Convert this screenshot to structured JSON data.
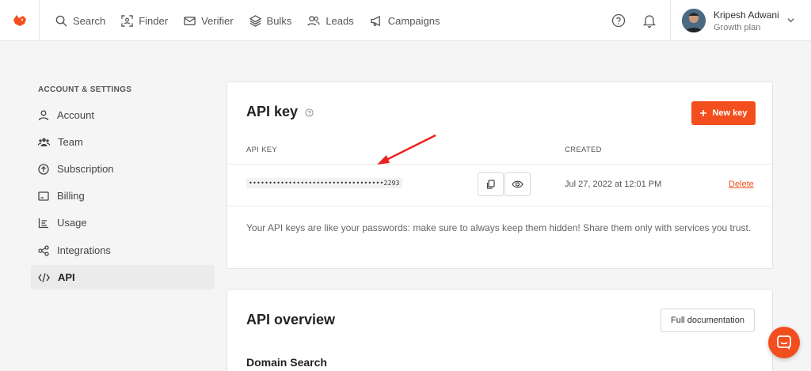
{
  "nav": {
    "items": [
      {
        "label": "Search",
        "icon": "search-icon"
      },
      {
        "label": "Finder",
        "icon": "finder-icon"
      },
      {
        "label": "Verifier",
        "icon": "verifier-icon"
      },
      {
        "label": "Bulks",
        "icon": "layers-icon"
      },
      {
        "label": "Leads",
        "icon": "users-icon"
      },
      {
        "label": "Campaigns",
        "icon": "megaphone-icon"
      }
    ]
  },
  "user": {
    "name": "Kripesh Adwani",
    "plan": "Growth plan"
  },
  "sidebar": {
    "title": "ACCOUNT & SETTINGS",
    "items": [
      {
        "label": "Account",
        "icon": "user-icon"
      },
      {
        "label": "Team",
        "icon": "team-icon"
      },
      {
        "label": "Subscription",
        "icon": "arrow-up-circle-icon"
      },
      {
        "label": "Billing",
        "icon": "billing-icon"
      },
      {
        "label": "Usage",
        "icon": "usage-chart-icon"
      },
      {
        "label": "Integrations",
        "icon": "share-nodes-icon"
      },
      {
        "label": "API",
        "icon": "code-icon"
      }
    ],
    "active": "API"
  },
  "api_key_card": {
    "title": "API key",
    "new_key_label": "New key",
    "col_key": "API KEY",
    "col_created": "CREATED",
    "key_masked": "••••••••••••••••••••••••••••••••••2293",
    "created": "Jul 27, 2022 at 12:01 PM",
    "delete_label": "Delete",
    "note": "Your API keys are like your passwords: make sure to always keep them hidden! Share them only with services you trust."
  },
  "overview_card": {
    "title": "API overview",
    "doc_label": "Full documentation",
    "subtitle": "Domain Search"
  },
  "colors": {
    "accent": "#f24e1e",
    "background": "#f5f5f5"
  }
}
